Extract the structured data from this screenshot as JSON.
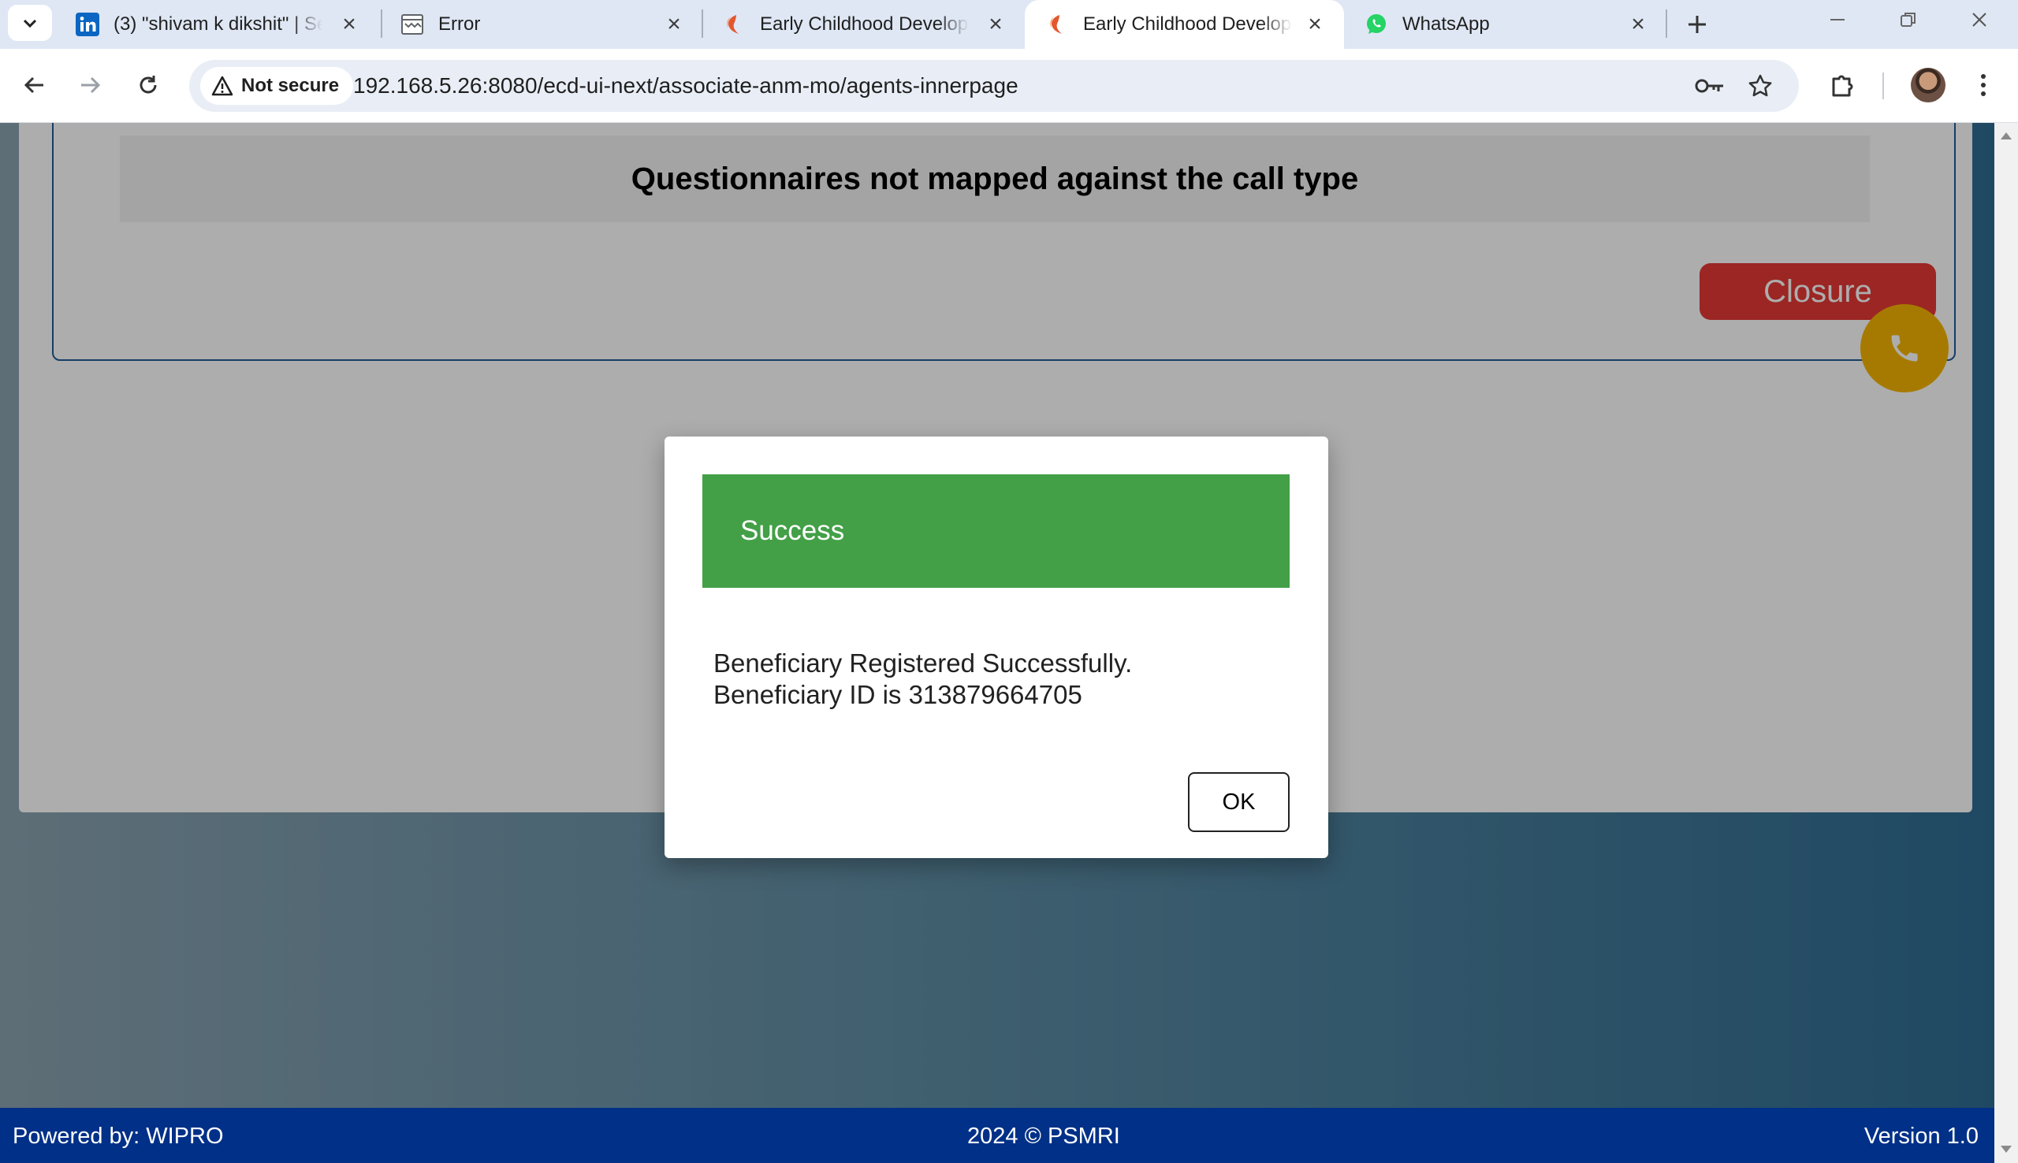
{
  "browser": {
    "tabs": [
      {
        "title": "(3) \"shivam k dikshit\" | Se",
        "icon": "linkedin-icon",
        "active": false
      },
      {
        "title": "Error",
        "icon": "broken-page-icon",
        "active": false
      },
      {
        "title": "Early Childhood Develop",
        "icon": "ecd-logo-icon",
        "active": false
      },
      {
        "title": "Early Childhood Develop",
        "icon": "ecd-logo-icon",
        "active": true
      },
      {
        "title": "WhatsApp",
        "icon": "whatsapp-icon",
        "active": false
      }
    ],
    "security_label": "Not secure",
    "url": "192.168.5.26:8080/ecd-ui-next/associate-anm-mo/agents-innerpage"
  },
  "page": {
    "questionnaire_message": "Questionnaires not mapped against the call type",
    "closure_label": "Closure",
    "colors": {
      "footer": "#003087",
      "closure": "#e53935",
      "call_button": "#f5b400",
      "success": "#43a047"
    }
  },
  "dialog": {
    "title": "Success",
    "message": "Beneficiary Registered Successfully. Beneficiary ID is 313879664705",
    "ok_label": "OK"
  },
  "footer": {
    "left": "Powered by: WIPRO",
    "center": "2024 © PSMRI",
    "right": "Version 1.0"
  }
}
